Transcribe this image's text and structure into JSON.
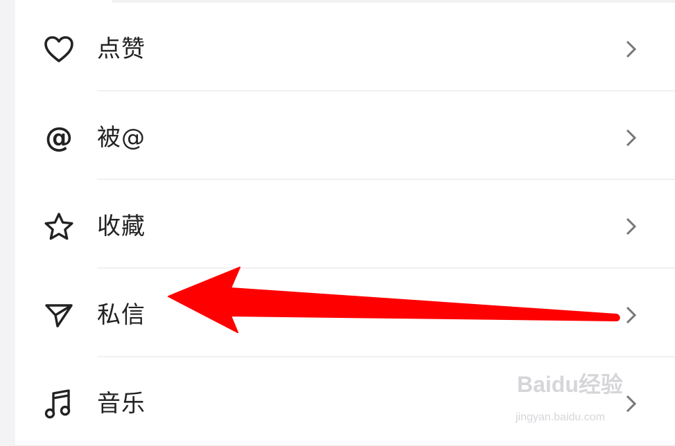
{
  "menu": {
    "items": [
      {
        "label": "点赞",
        "icon": "heart-icon"
      },
      {
        "label": "被@",
        "icon": "at-icon"
      },
      {
        "label": "收藏",
        "icon": "star-icon"
      },
      {
        "label": "私信",
        "icon": "send-icon"
      },
      {
        "label": "音乐",
        "icon": "music-note-icon"
      }
    ]
  },
  "annotation": {
    "arrow_color": "#ff0000"
  },
  "watermark": {
    "logo": "Baidu经验",
    "url": "jingyan.baidu.com"
  }
}
